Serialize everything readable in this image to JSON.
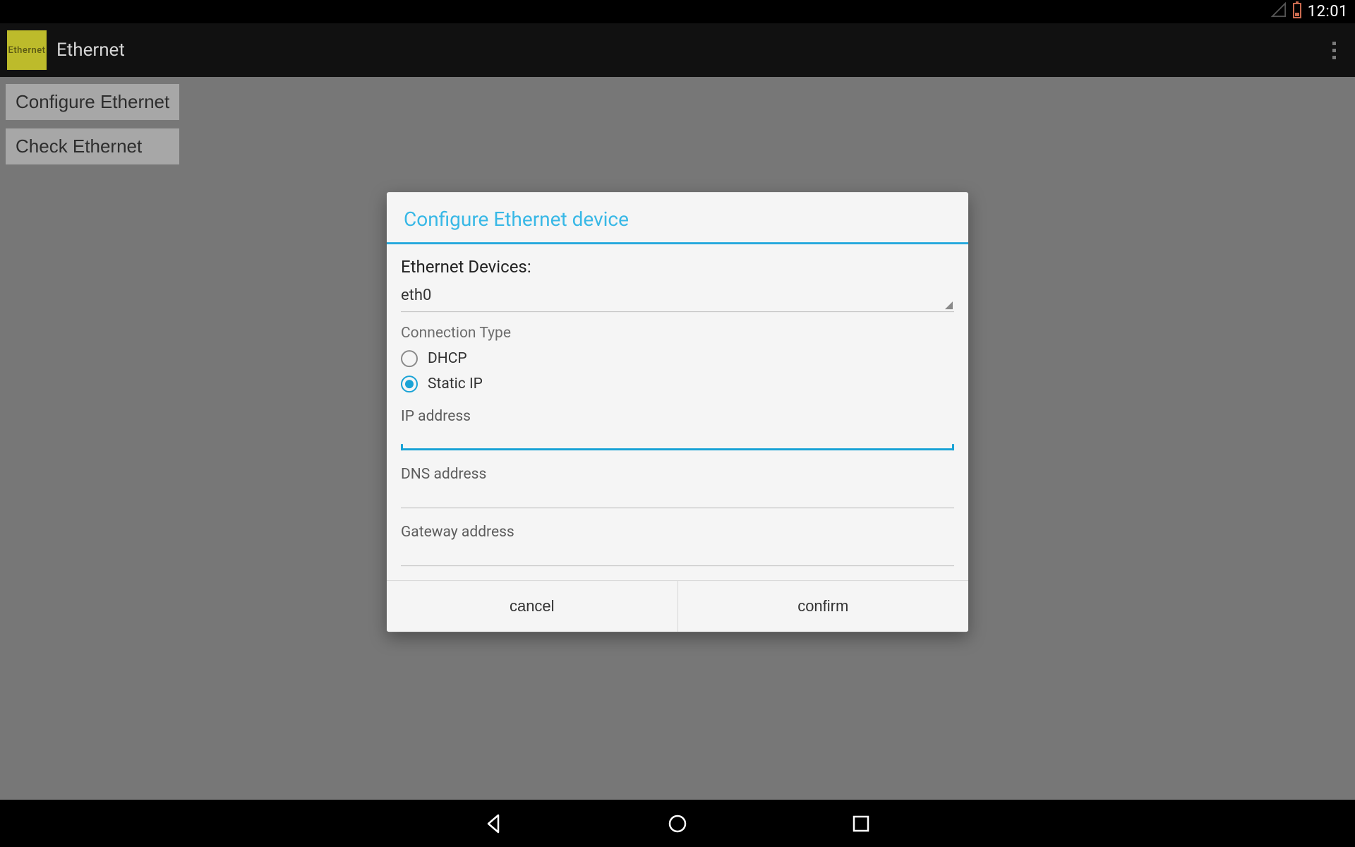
{
  "status": {
    "clock": "12:01"
  },
  "app": {
    "icon_label": "Ethernet",
    "title": "Ethernet"
  },
  "background": {
    "configure_label": "Configure Ethernet",
    "check_label": "Check Ethernet"
  },
  "dialog": {
    "title": "Configure Ethernet device",
    "devices_label": "Ethernet Devices:",
    "selected_device": "eth0",
    "connection_type_label": "Connection Type",
    "radio": {
      "dhcp_label": "DHCP",
      "static_label": "Static IP",
      "selected": "static"
    },
    "fields": {
      "ip_label": "IP address",
      "ip_value": "",
      "dns_label": "DNS address",
      "dns_value": "",
      "gateway_label": "Gateway address",
      "gateway_value": ""
    },
    "buttons": {
      "cancel": "cancel",
      "confirm": "confirm"
    }
  }
}
